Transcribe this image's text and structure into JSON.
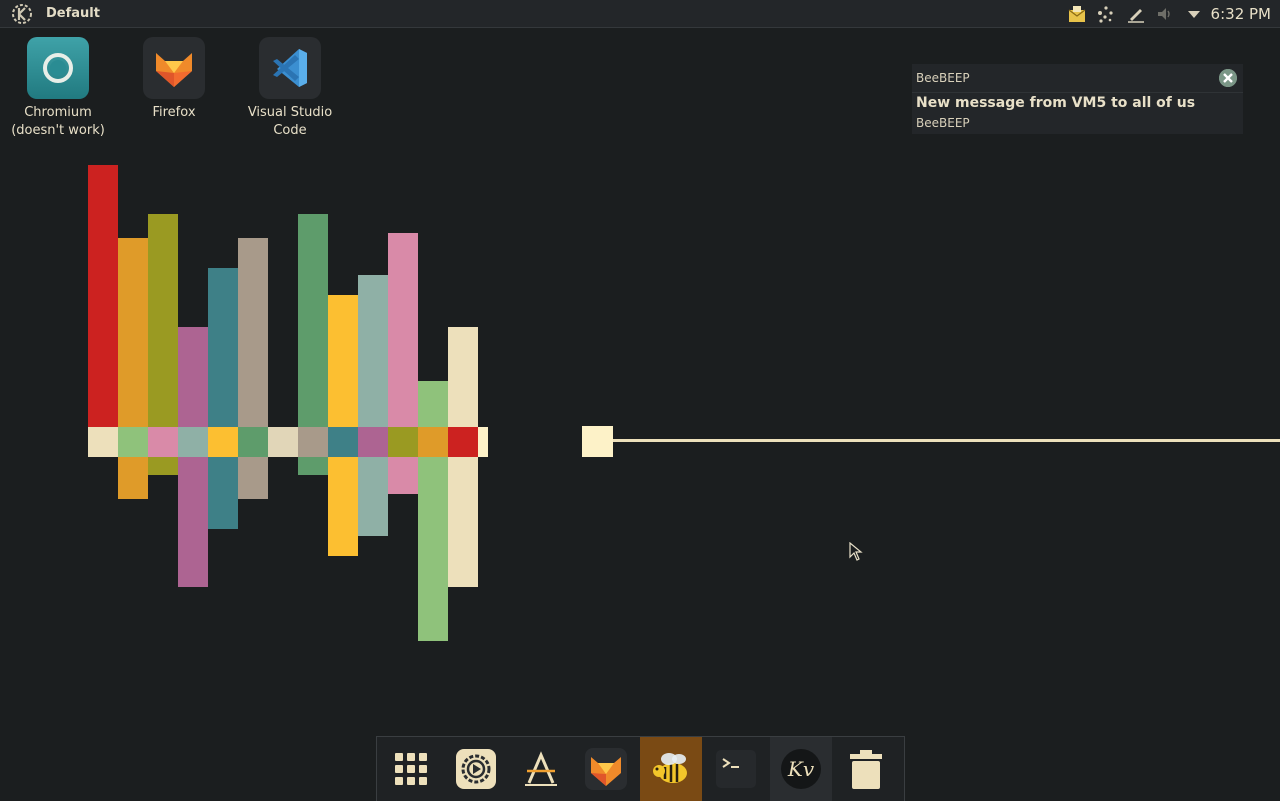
{
  "panel": {
    "activity_name": "Default",
    "clock": "6:32 PM",
    "tray_icons": [
      "mail-icon",
      "network-icon",
      "pen-icon",
      "volume-icon",
      "expand-tray-icon"
    ]
  },
  "desktop": {
    "icons": [
      {
        "label": "Chromium\n(doesn't work)",
        "line1": "Chromium",
        "line2": "(doesn't work)",
        "icon": "chromium-icon"
      },
      {
        "label": "Firefox",
        "line1": "Firefox",
        "line2": "",
        "icon": "firefox-icon"
      },
      {
        "label": "Visual Studio Code",
        "line1": "Visual Studio",
        "line2": "Code",
        "icon": "vscode-icon"
      }
    ]
  },
  "notification": {
    "app": "BeeBEEP",
    "title": "New message from VM5 to all of us",
    "body": "BeeBEEP"
  },
  "dock": {
    "items": [
      "app-launcher-icon",
      "settings-icon",
      "text-editor-icon",
      "firefox-icon",
      "beebeep-icon",
      "terminal-icon",
      "kvantum-icon",
      "trash-icon"
    ]
  },
  "colors": {
    "background": "#1b1e1f",
    "panel": "#232629",
    "dock_active": "#7a4a14",
    "cream": "#ede0bb"
  }
}
